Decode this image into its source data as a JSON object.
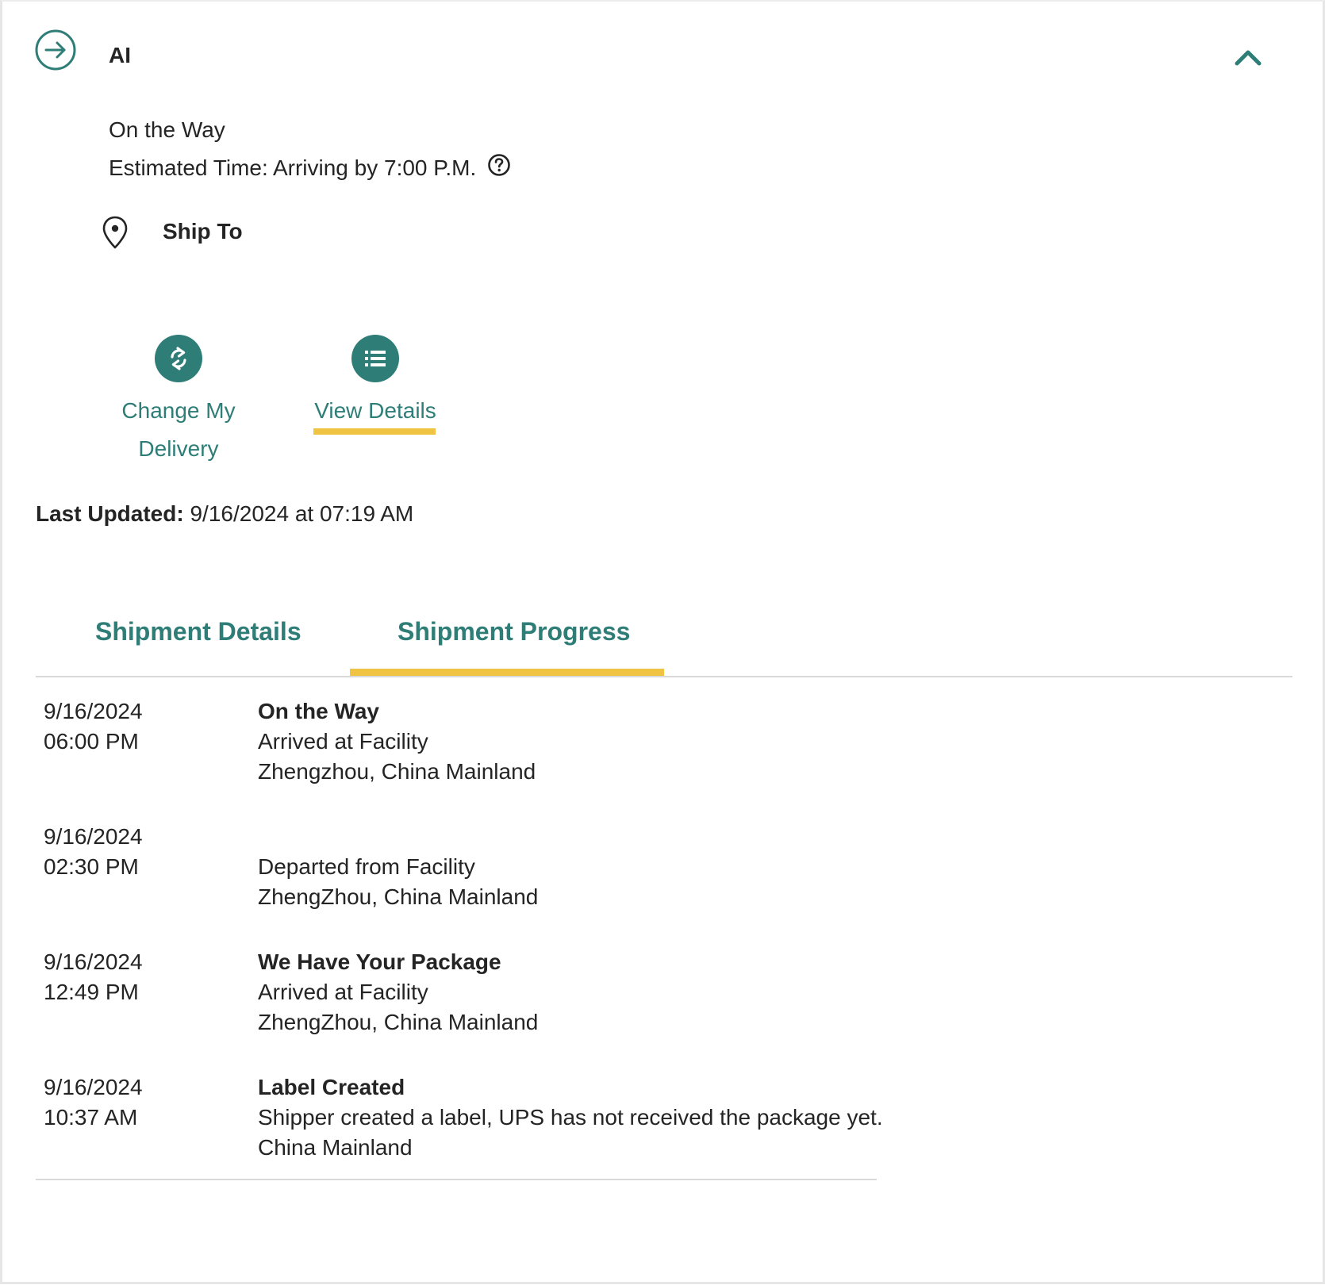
{
  "header": {
    "title": "AI",
    "icon": "arrow-right-circle-icon",
    "collapse_icon": "chevron-up-icon"
  },
  "status": {
    "label": "On the Way",
    "eta": "Estimated Time: Arriving by 7:00 P.M.",
    "help_icon": "question-circle-icon"
  },
  "ship_to": {
    "label": "Ship To",
    "icon": "location-pin-icon"
  },
  "actions": [
    {
      "label_line1": "Change My",
      "label_line2": "Delivery",
      "icon": "refresh-swap-icon"
    },
    {
      "label": "View Details",
      "icon": "list-icon"
    }
  ],
  "last_updated": {
    "label": "Last Updated:",
    "value": "9/16/2024 at 07:19 AM"
  },
  "tabs": [
    {
      "label": "Shipment Details",
      "active": false
    },
    {
      "label": "Shipment Progress",
      "active": true
    }
  ],
  "progress": [
    {
      "date": "9/16/2024",
      "time": "06:00 PM",
      "title": "On the Way",
      "detail": "Arrived at Facility",
      "location": "Zhengzhou, China Mainland"
    },
    {
      "date": "9/16/2024",
      "time": "02:30 PM",
      "title": "",
      "detail": "Departed from Facility",
      "location": "ZhengZhou, China Mainland"
    },
    {
      "date": "9/16/2024",
      "time": "12:49 PM",
      "title": "We Have Your Package",
      "detail": "Arrived at Facility",
      "location": "ZhengZhou, China Mainland"
    },
    {
      "date": "9/16/2024",
      "time": "10:37 AM",
      "title": "Label Created",
      "detail": "Shipper created a label, UPS has not received the package yet.",
      "location": "China Mainland"
    }
  ],
  "colors": {
    "accent": "#2e7d77",
    "highlight": "#f0c342",
    "text": "#242424",
    "divider": "#d9d9d9"
  }
}
